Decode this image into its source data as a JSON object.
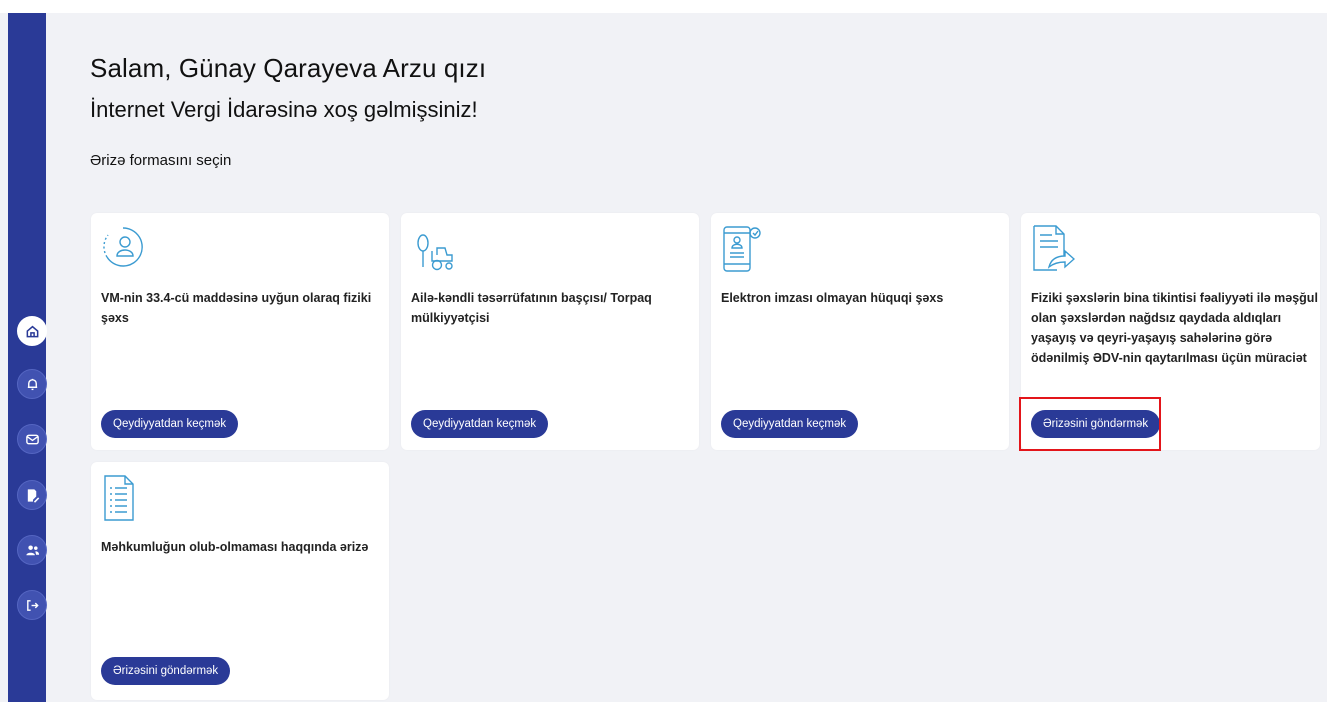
{
  "header": {
    "greeting": "Salam, Günay Qarayeva Arzu qızı",
    "welcome": "İnternet Vergi İdarəsinə xoş gəlmişsiniz!",
    "section_label": "Ərizə formasını seçin"
  },
  "sidebar": {
    "items": [
      {
        "name": "home",
        "icon": "home-icon",
        "active": true
      },
      {
        "name": "notifications",
        "icon": "bell-icon",
        "active": false
      },
      {
        "name": "messages",
        "icon": "mail-icon",
        "active": false
      },
      {
        "name": "documents",
        "icon": "document-edit-icon",
        "active": false
      },
      {
        "name": "users",
        "icon": "users-icon",
        "active": false
      },
      {
        "name": "logout",
        "icon": "logout-icon",
        "active": false
      }
    ]
  },
  "cards": [
    {
      "icon": "person-icon",
      "title_line1": "VM-nin 33.4-cü maddəsinə uyğun olaraq fiziki",
      "title_line2": "şəxs",
      "button": "Qeydiyyatdan keçmək"
    },
    {
      "icon": "farm-tractor-icon",
      "title_line1": "Ailə-kəndli təsərrüfatının başçısı/ Torpaq",
      "title_line2": "mülkiyyətçisi",
      "button": "Qeydiyyatdan keçmək"
    },
    {
      "icon": "phone-id-icon",
      "title_line1": "Elektron imzası olmayan hüquqi şəxs",
      "button": "Qeydiyyatdan keçmək"
    },
    {
      "icon": "document-return-icon",
      "title_line1": "Fiziki şəxslərin bina tikintisi fəaliyyəti ilə məşğul",
      "title_line2": "olan şəxslərdən nağdsız qaydada aldıqları",
      "title_line3": "yaşayış və qeyri-yaşayış sahələrinə görə",
      "title_line4": "ödənilmiş ƏDV-nin qaytarılması üçün müraciət",
      "button": "Ərizəsini göndərmək"
    },
    {
      "icon": "document-list-icon",
      "title_line1": "Məhkumluğun olub-olmaması haqqında ərizə",
      "button": "Ərizəsini göndərmək"
    }
  ],
  "colors": {
    "primary": "#2a3a97",
    "background": "#f1f2f6",
    "icon_stroke": "#3b9bd1",
    "highlight": "#e3151a"
  }
}
